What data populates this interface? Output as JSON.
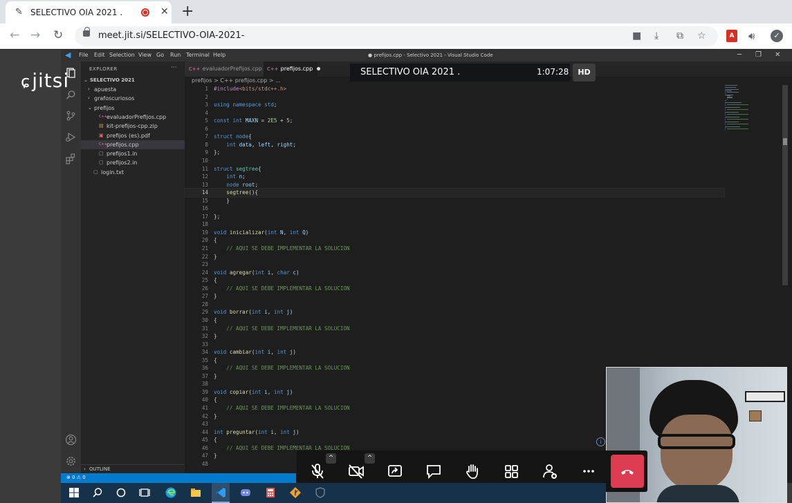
{
  "browser": {
    "tab_title": "SELECTIVO OIA 2021 .",
    "new_tab": "+",
    "close": "✕",
    "url": "meet.jit.si/SELECTIVO-OIA-2021-"
  },
  "jitsi": {
    "logo": "jitsi",
    "meeting_name": "SELECTIVO OIA 2021 .",
    "timer": "1:07:28",
    "quality": "HD"
  },
  "vscode": {
    "menu": [
      "File",
      "Edit",
      "Selection",
      "View",
      "Go",
      "Run",
      "Terminal",
      "Help"
    ],
    "window_title": "● prefijos.cpp - Selectivo 2021 - Visual Studio Code",
    "explorer_title": "EXPLORER",
    "explorer_more": "···",
    "workspace": "SELECTIVO 2021",
    "tree": [
      {
        "label": "apuesta",
        "depth": 1,
        "kind": "folder",
        "open": false
      },
      {
        "label": "grafoscuriosos",
        "depth": 1,
        "kind": "folder",
        "open": false
      },
      {
        "label": "prefijos",
        "depth": 1,
        "kind": "folder",
        "open": true
      },
      {
        "label": "evaluadorPrefijos.cpp",
        "depth": 2,
        "kind": "cpp"
      },
      {
        "label": "kit-prefijos-cpp.zip",
        "depth": 2,
        "kind": "zip"
      },
      {
        "label": "prefijos (es).pdf",
        "depth": 2,
        "kind": "pdf"
      },
      {
        "label": "prefijos.cpp",
        "depth": 2,
        "kind": "cpp",
        "selected": true
      },
      {
        "label": "prefijos1.in",
        "depth": 2,
        "kind": "file"
      },
      {
        "label": "prefijos2.in",
        "depth": 2,
        "kind": "file"
      },
      {
        "label": "login.txt",
        "depth": 1,
        "kind": "file"
      }
    ],
    "outline": "OUTLINE",
    "tabs": [
      {
        "label": "evaluadorPrefijos.cpp",
        "active": false
      },
      {
        "label": "prefijos.cpp",
        "active": true
      }
    ],
    "breadcrumb": "prefijos > C++ prefijos.cpp > ...",
    "status_left": "⊗ 0 ⚠ 0",
    "current_line": 14,
    "code": [
      "#include<bits/stdc++.h>",
      "",
      "using namespace std;",
      "",
      "const int MAXN = 2E5 + 5;",
      "",
      "struct node{",
      "    int data, left, right;",
      "};",
      "",
      "struct segtree{",
      "    int n;",
      "    node root;",
      "    segtree(){",
      "    }",
      "",
      "};",
      "",
      "void inicializar(int N, int Q)",
      "{",
      "    // AQUI SE DEBE IMPLEMENTAR LA SOLUCION",
      "}",
      "",
      "void agregar(int i, char c)",
      "{",
      "    // AQUI SE DEBE IMPLEMENTAR LA SOLUCION",
      "}",
      "",
      "void borrar(int i, int j)",
      "{",
      "    // AQUI SE DEBE IMPLEMENTAR LA SOLUCION",
      "}",
      "",
      "void cambiar(int i, int j)",
      "{",
      "    // AQUI SE DEBE IMPLEMENTAR LA SOLUCION",
      "}",
      "",
      "void copiar(int i, int j)",
      "{",
      "    // AQUI SE DEBE IMPLEMENTAR LA SOLUCION",
      "}",
      "",
      "int preguntar(int i, int j)",
      "{",
      "    // AQUI SE DEBE IMPLEMENTAR LA SOLUCION",
      "}",
      ""
    ]
  },
  "toolbox": {
    "buttons": [
      "microphone-muted",
      "camera-off",
      "share-screen",
      "chat",
      "raise-hand",
      "tile-view",
      "participants",
      "more",
      "hangup"
    ]
  },
  "colors": {
    "hangup": "#dd3b4f",
    "vscode_status": "#007acc",
    "taskbar": "#16324a"
  }
}
